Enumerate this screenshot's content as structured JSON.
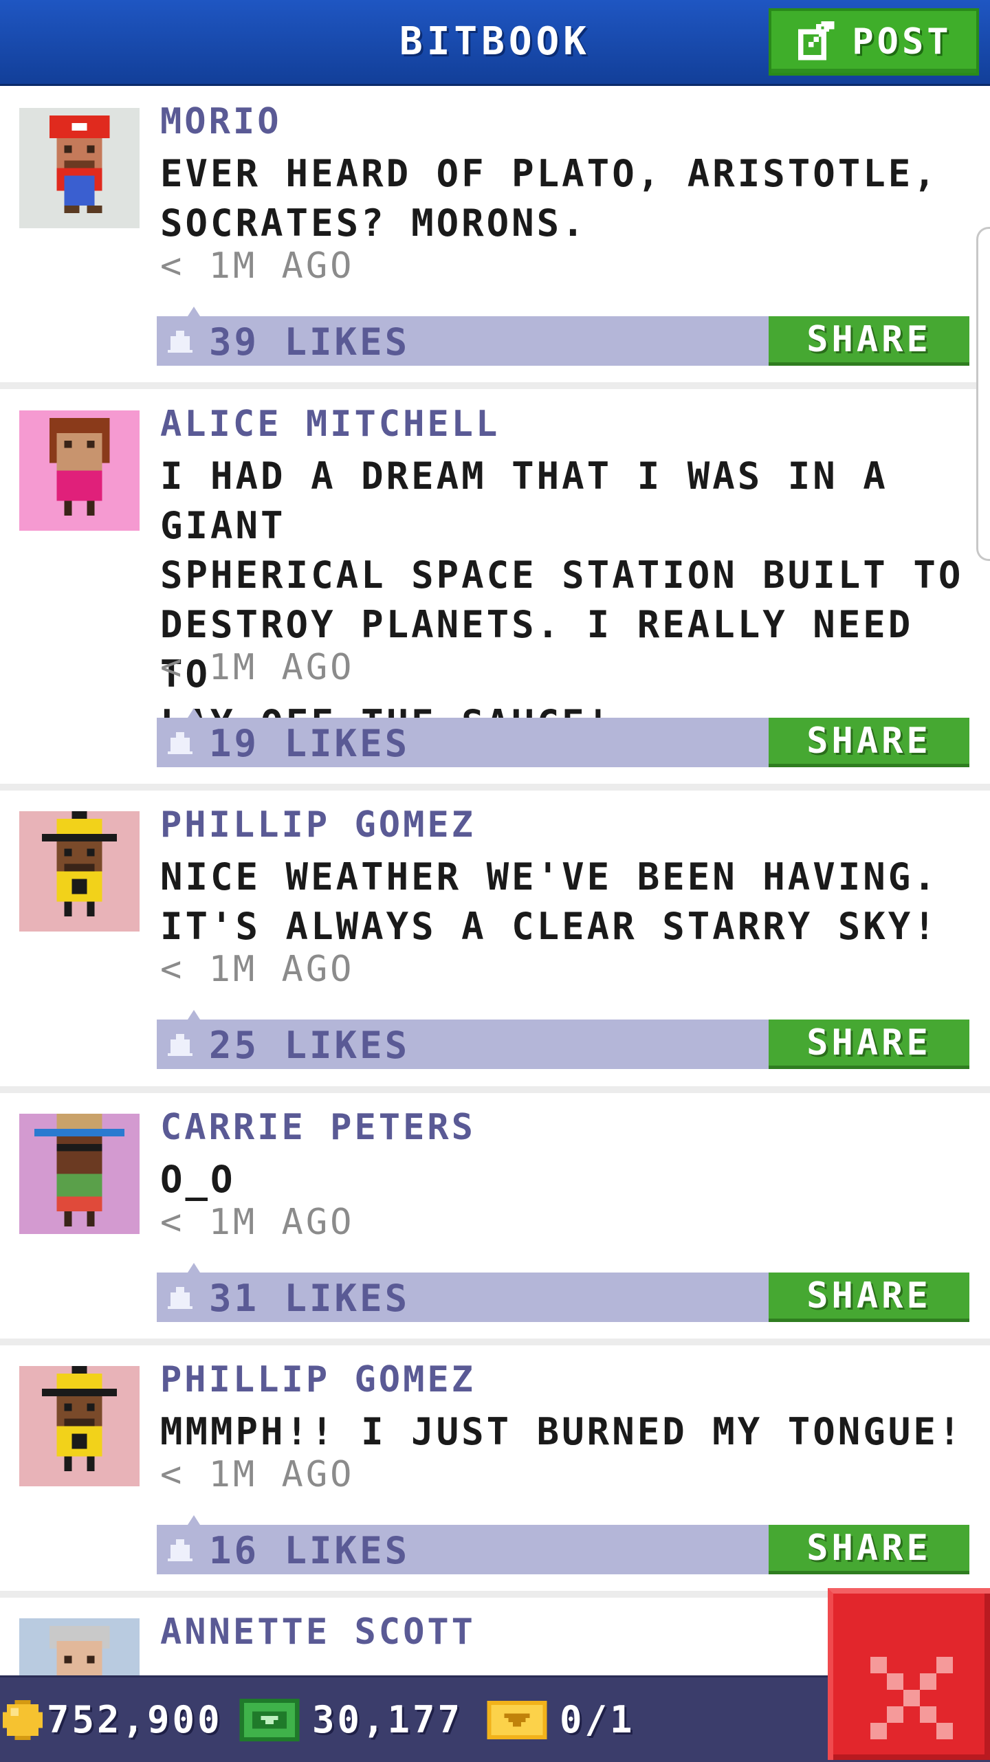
{
  "header": {
    "title": "BITBOOK",
    "post_label": "POST"
  },
  "posts": [
    {
      "author": "MORIO",
      "text": "EVER HEARD OF PLATO, ARISTOTLE,\nSOCRATES? MORONS.",
      "time": "< 1M AGO",
      "likes": "39 LIKES",
      "share_label": "SHARE",
      "avatar_bg": "#dfe3e0"
    },
    {
      "author": "ALICE MITCHELL",
      "text": "I HAD A DREAM THAT I WAS IN A GIANT\nSPHERICAL SPACE STATION BUILT TO\nDESTROY PLANETS. I REALLY NEED TO\nLAY OFF THE SAUCE!",
      "time": "< 1M AGO",
      "likes": "19 LIKES",
      "share_label": "SHARE",
      "avatar_bg": "#f59ad1"
    },
    {
      "author": "PHILLIP GOMEZ",
      "text": "NICE WEATHER WE'VE BEEN HAVING.\nIT'S ALWAYS A CLEAR STARRY SKY!",
      "time": "< 1M AGO",
      "likes": "25 LIKES",
      "share_label": "SHARE",
      "avatar_bg": "#e8b3b8"
    },
    {
      "author": "CARRIE PETERS",
      "text": "O_O",
      "time": "< 1M AGO",
      "likes": "31 LIKES",
      "share_label": "SHARE",
      "avatar_bg": "#d39ad0"
    },
    {
      "author": "PHILLIP GOMEZ",
      "text": "MMMPH!! I JUST BURNED MY TONGUE!",
      "time": "< 1M AGO",
      "likes": "16 LIKES",
      "share_label": "SHARE",
      "avatar_bg": "#e8b3b8"
    },
    {
      "author": "ANNETTE SCOTT",
      "avatar_bg": "#b9cbe0"
    }
  ],
  "bottom_bar": {
    "coins": "752,900",
    "bux": "30,177",
    "tickets": "0/1"
  },
  "colors": {
    "header": "#1a4db5",
    "share": "#46a832",
    "likes_bar": "#b4b6d8",
    "close": "#e2262c"
  }
}
